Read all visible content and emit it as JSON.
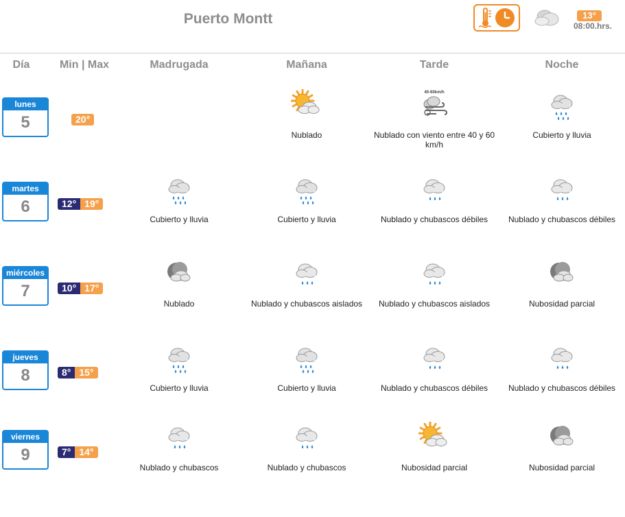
{
  "header": {
    "city": "Puerto Montt",
    "now_temp": "13°",
    "now_time": "08:00.hrs.",
    "hourly_button_icon": "thermometer-clock-icon",
    "now_icon": "cloudy-icon"
  },
  "columns": [
    "Día",
    "Min | Max",
    "Madrugada",
    "Mañana",
    "Tarde",
    "Noche"
  ],
  "days": [
    {
      "weekday": "lunes",
      "num": "5",
      "min": "",
      "max": "20°",
      "periods": [
        null,
        {
          "icon": "sun-cloud",
          "text": "Nublado"
        },
        {
          "icon": "wind",
          "text": "Nublado con viento entre 40 y 60 km/h",
          "wind_label": "40-60km/h"
        },
        {
          "icon": "rain",
          "text": "Cubierto y lluvia"
        }
      ]
    },
    {
      "weekday": "martes",
      "num": "6",
      "min": "12°",
      "max": "19°",
      "periods": [
        {
          "icon": "rain",
          "text": "Cubierto y lluvia"
        },
        {
          "icon": "rain",
          "text": "Cubierto y lluvia"
        },
        {
          "icon": "showers",
          "text": "Nublado y chubascos débiles"
        },
        {
          "icon": "showers",
          "text": "Nublado y chubascos débiles"
        }
      ]
    },
    {
      "weekday": "miércoles",
      "num": "7",
      "min": "10°",
      "max": "17°",
      "periods": [
        {
          "icon": "moon-cloud",
          "text": "Nublado"
        },
        {
          "icon": "showers",
          "text": "Nublado y chubascos aislados"
        },
        {
          "icon": "showers",
          "text": "Nublado y chubascos aislados"
        },
        {
          "icon": "moon-cloud",
          "text": "Nubosidad parcial"
        }
      ]
    },
    {
      "weekday": "jueves",
      "num": "8",
      "min": "8°",
      "max": "15°",
      "periods": [
        {
          "icon": "rain",
          "text": "Cubierto y lluvia"
        },
        {
          "icon": "rain",
          "text": "Cubierto y lluvia"
        },
        {
          "icon": "showers",
          "text": "Nublado y chubascos débiles"
        },
        {
          "icon": "showers",
          "text": "Nublado y chubascos débiles"
        }
      ]
    },
    {
      "weekday": "viernes",
      "num": "9",
      "min": "7°",
      "max": "14°",
      "periods": [
        {
          "icon": "showers",
          "text": "Nublado y chubascos"
        },
        {
          "icon": "showers",
          "text": "Nublado y chubascos"
        },
        {
          "icon": "sun-cloud",
          "text": "Nubosidad parcial"
        },
        {
          "icon": "moon-cloud",
          "text": "Nubosidad parcial"
        }
      ]
    }
  ],
  "colors": {
    "accent_blue": "#1a86d8",
    "min_bg": "#2b2b74",
    "max_bg": "#f5a04a",
    "orange": "#f08a24",
    "header_gray": "#8d8d8d"
  }
}
